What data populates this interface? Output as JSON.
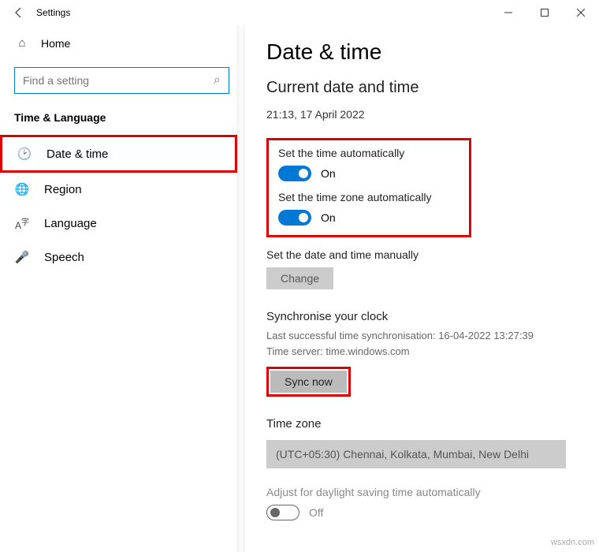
{
  "window": {
    "title": "Settings"
  },
  "sidebar": {
    "home": "Home",
    "search_placeholder": "Find a setting",
    "section": "Time & Language",
    "items": [
      {
        "label": "Date & time",
        "icon": "🕑"
      },
      {
        "label": "Region",
        "icon": "🌐"
      },
      {
        "label": "Language",
        "icon": "A字"
      },
      {
        "label": "Speech",
        "icon": "🎤"
      }
    ]
  },
  "main": {
    "title": "Date & time",
    "subtitle": "Current date and time",
    "datetime": "21:13, 17 April 2022",
    "auto_time": {
      "label": "Set the time automatically",
      "state": "On"
    },
    "auto_tz": {
      "label": "Set the time zone automatically",
      "state": "On"
    },
    "manual": {
      "label": "Set the date and time manually",
      "button": "Change"
    },
    "sync": {
      "header": "Synchronise your clock",
      "last": "Last successful time synchronisation: 16-04-2022 13:27:39",
      "server": "Time server: time.windows.com",
      "button": "Sync now"
    },
    "tz": {
      "header": "Time zone",
      "value": "(UTC+05:30) Chennai, Kolkata, Mumbai, New Delhi"
    },
    "dst": {
      "label": "Adjust for daylight saving time automatically",
      "state": "Off"
    }
  },
  "watermark": "wsxdn.com"
}
